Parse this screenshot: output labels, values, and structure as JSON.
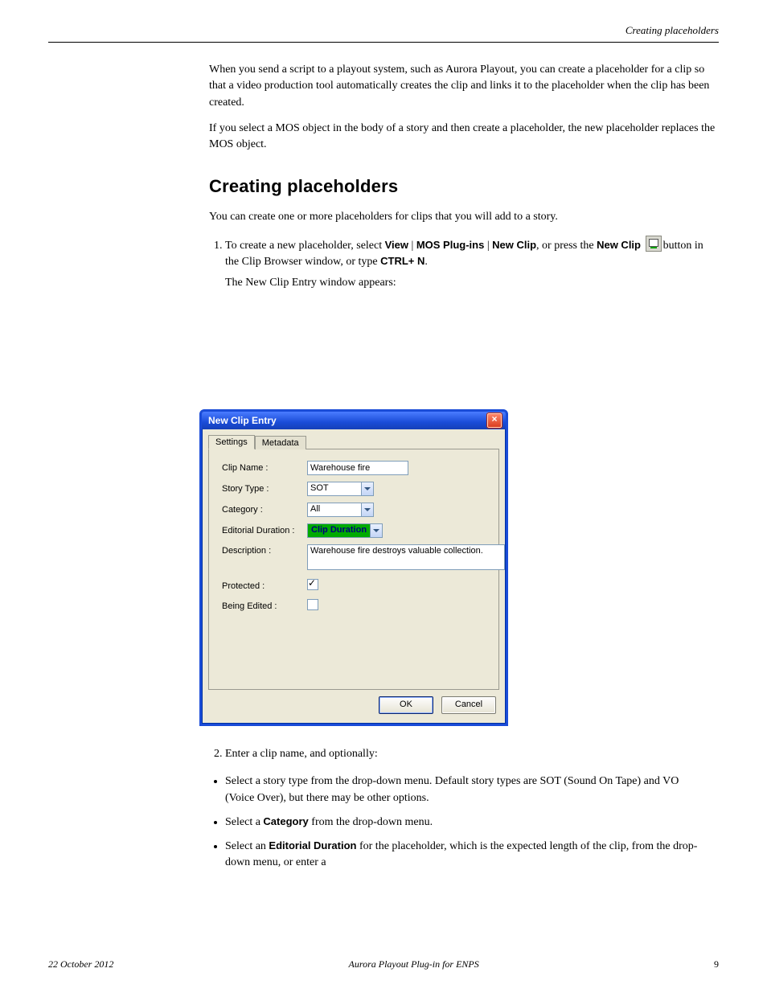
{
  "runningHead": "Creating placeholders",
  "intro": {
    "p1a": "When you send a script to a playout system, such as Aurora Playout, you can create a placeholder for a clip so that a video production tool automatically creates the clip and links it to the placeholder when the clip has been created.",
    "p1b": "If you select a MOS object in the body of a story and then create a placeholder, the new placeholder replaces the MOS object."
  },
  "h2": "Creating placeholders",
  "p2": "You can create one or more placeholders for clips that you will add to a story.",
  "steps": {
    "s1a": "To create a new placeholder, select ",
    "s1b": " | ",
    "s1c": " | ",
    "s1d": ", or press the ",
    "s1e": "New Clip ",
    "s1f": "button in the Clip Browser window, or type ",
    "s1g": ".",
    "s1sub": "The New Clip Entry window appears:",
    "view": "View",
    "mos": "MOS Plug-ins",
    "newclip": "New Clip",
    "shortcut": "CTRL+ N"
  },
  "dialog": {
    "title": "New Clip Entry",
    "tabs": {
      "settings": "Settings",
      "metadata": "Metadata"
    },
    "labels": {
      "clipName": "Clip Name :",
      "storyType": "Story Type :",
      "category": "Category :",
      "editorialDuration": "Editorial Duration :",
      "description": "Description :",
      "protected": "Protected :",
      "beingEdited": "Being Edited :"
    },
    "values": {
      "clipName": "Warehouse fire",
      "storyType": "SOT",
      "category": "All",
      "editorialDuration": "Clip Duration",
      "description": "Warehouse fire destroys valuable collection.",
      "protectedChecked": true,
      "beingEditedChecked": false
    },
    "buttons": {
      "ok": "OK",
      "cancel": "Cancel"
    }
  },
  "step2": "Enter a clip name, and optionally:",
  "bullets": {
    "b1": "Select a story type from the drop-down menu. Default story types are SOT (Sound On Tape) and VO (Voice Over), but there may be other options.",
    "b2a": "Select a ",
    "b2b": " from the drop-down menu.",
    "b2c": "Category",
    "b3a": "Select an ",
    "b3b": " for the placeholder, which is the expected length of the clip, from the drop-down menu, or enter a",
    "b3c": "Editorial Duration"
  },
  "footer": {
    "date": "22 October 2012",
    "doc": "Aurora Playout Plug-in for ENPS",
    "page": "9"
  }
}
